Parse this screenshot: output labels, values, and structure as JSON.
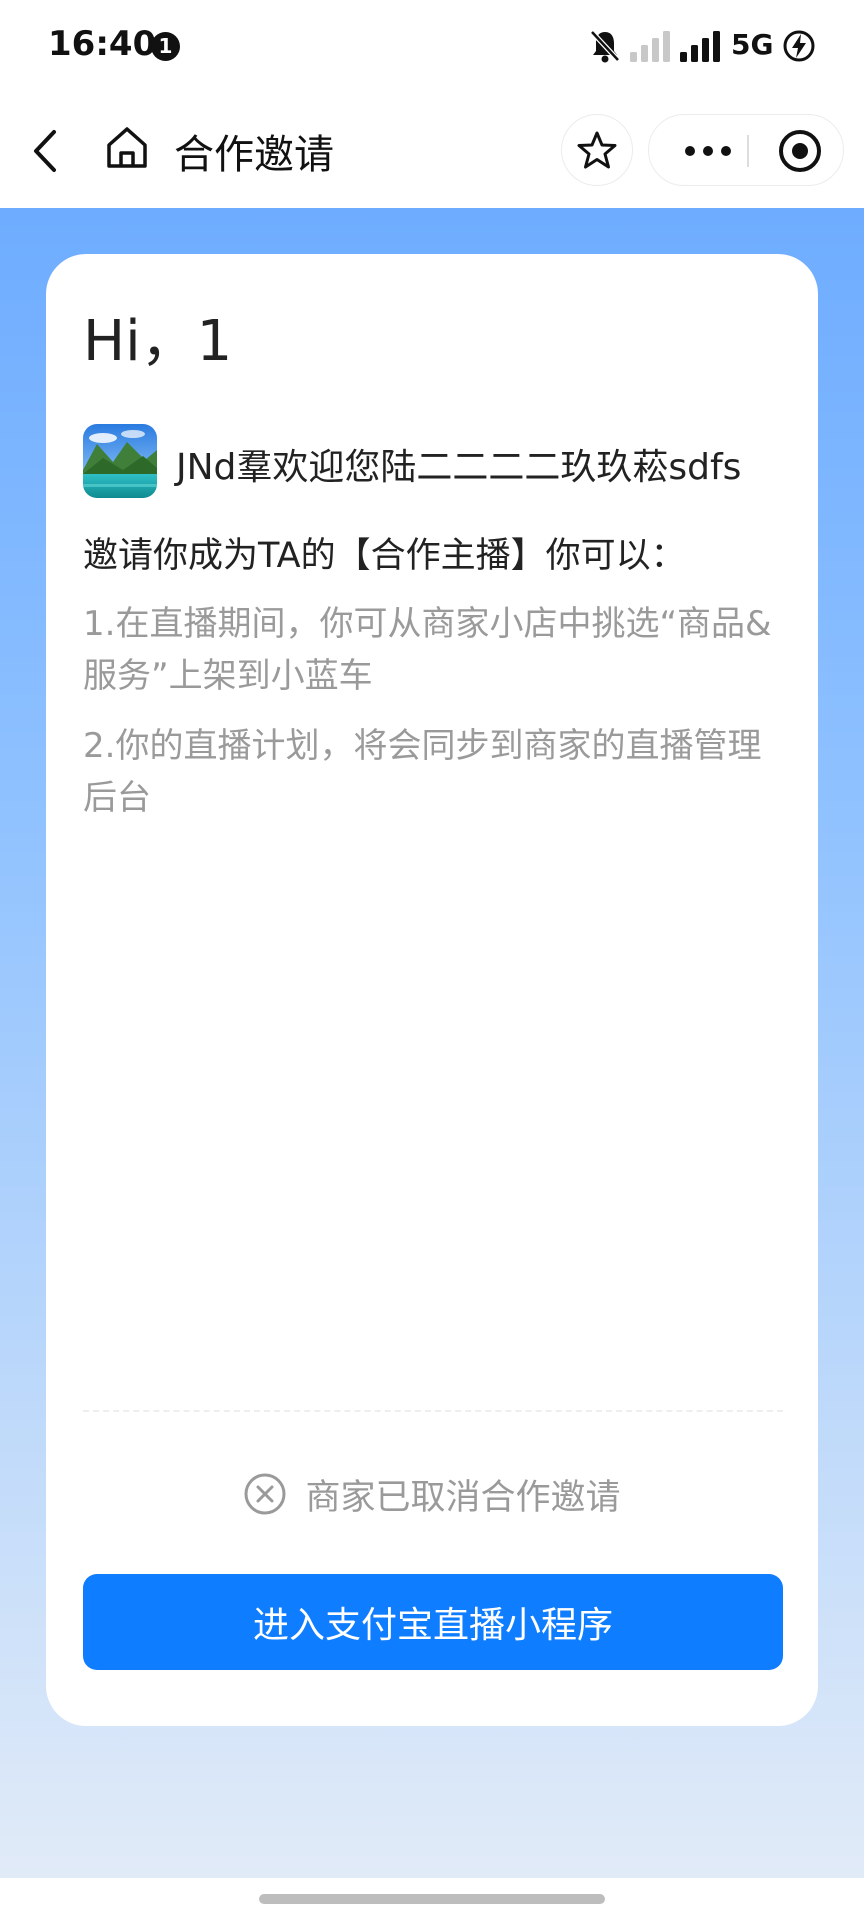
{
  "status_bar": {
    "time": "16:40",
    "notification_count": "1",
    "network": "5G",
    "icons": [
      "bell-muted-icon",
      "signal-weak-icon",
      "signal-strong-icon",
      "battery-charging-icon"
    ]
  },
  "nav": {
    "title": "合作邀请",
    "icons": [
      "back-icon",
      "home-icon",
      "star-icon",
      "more-icon",
      "close-miniapp-icon"
    ]
  },
  "card": {
    "greeting": "Hi，1",
    "shop_name": "JNd羣欢迎您陆二二二二玖玖菘sdfs",
    "invite_line": "邀请你成为TA的【合作主播】你可以：",
    "rules": [
      "1.在直播期间，你可从商家小店中挑选“商品&服务”上架到小蓝车",
      "2.你的直播计划，将会同步到商家的直播管理后台"
    ],
    "status_text": "商家已取消合作邀请",
    "button_label": "进入支付宝直播小程序"
  },
  "colors": {
    "accent": "#0f7dff",
    "background_top": "#6eacff",
    "background_bottom": "#e1ebf8",
    "muted_text": "#9a9a9a"
  }
}
